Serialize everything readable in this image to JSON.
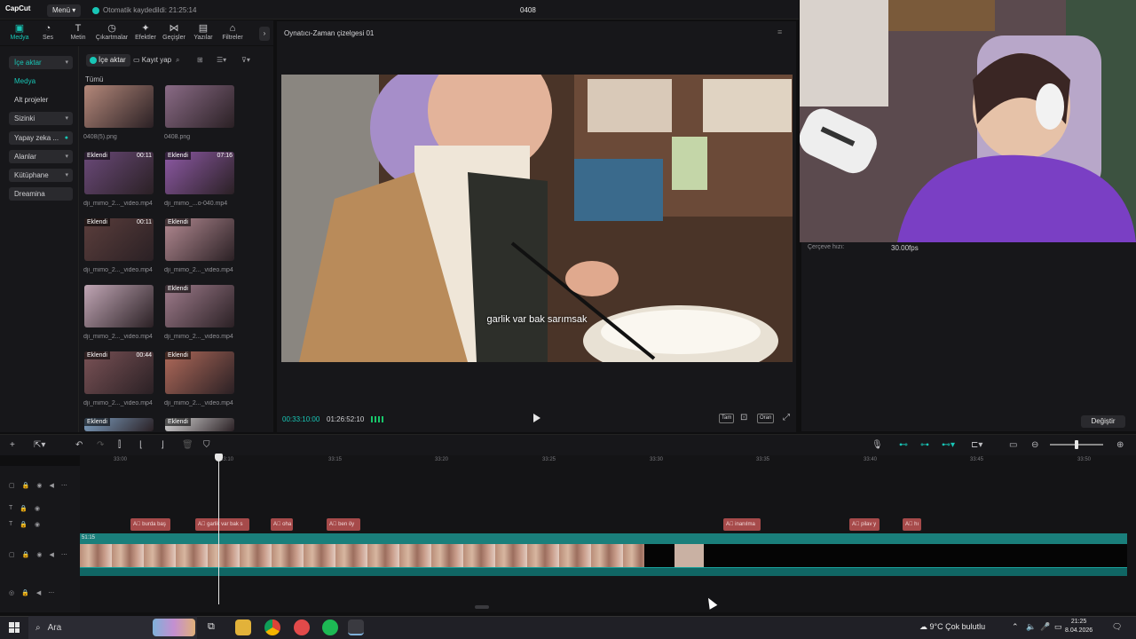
{
  "app": {
    "logo": "CapCut",
    "menu_label": "Menü",
    "autosave": "Otomatik kaydedildi: 21:25:14",
    "project_title": "0408"
  },
  "toolbar": {
    "items": [
      "Medya",
      "Ses",
      "Metin",
      "Çıkartmalar",
      "Efektler",
      "Geçişler",
      "Yazılar",
      "Filtreler"
    ],
    "active": "Medya",
    "more": "›"
  },
  "leftnav": {
    "items": [
      {
        "label": "İçe aktar",
        "chevron": "▾",
        "state": "highlight"
      },
      {
        "label": "Medya",
        "chevron": "",
        "state": "teal"
      },
      {
        "label": "Alt projeler",
        "chevron": "",
        "state": ""
      },
      {
        "label": "Sizinki",
        "chevron": "▾",
        "state": ""
      },
      {
        "label": "Yapay zeka ...",
        "chevron": "",
        "state": ""
      },
      {
        "label": "Alanlar",
        "chevron": "▾",
        "state": ""
      },
      {
        "label": "Kütüphane",
        "chevron": "▾",
        "state": ""
      },
      {
        "label": "Dreamina",
        "chevron": "",
        "state": ""
      }
    ]
  },
  "media": {
    "import_label": "İçe aktar",
    "record_label": "Kayıt yap",
    "all_label": "Tümü",
    "items": [
      {
        "name": "0408(5).png",
        "badge": "",
        "duration": "",
        "color": "#b4887a"
      },
      {
        "name": "0408.png",
        "badge": "",
        "duration": "",
        "color": "#8a6b86"
      },
      {
        "name": "dji_mimo_2..._video.mp4",
        "badge": "Eklendi",
        "duration": "00:11",
        "color": "#6b4a7a"
      },
      {
        "name": "dji_mimo_...o-040.mp4",
        "badge": "Eklendi",
        "duration": "07:16",
        "color": "#8e5aa6"
      },
      {
        "name": "dji_mimo_2..._video.mp4",
        "badge": "Eklendi",
        "duration": "00:11",
        "color": "#5b3e3c"
      },
      {
        "name": "dji_mimo_2..._video.mp4",
        "badge": "Eklendi",
        "duration": "",
        "color": "#b38a92"
      },
      {
        "name": "dji_mimo_2..._video.mp4",
        "badge": "",
        "duration": "",
        "color": "#c1a6b5"
      },
      {
        "name": "dji_mimo_2..._video.mp4",
        "badge": "Eklendi",
        "duration": "",
        "color": "#9f7c8c"
      },
      {
        "name": "dji_mimo_2..._video.mp4",
        "badge": "Eklendi",
        "duration": "00:44",
        "color": "#7a5256"
      },
      {
        "name": "dji_mimo_2..._video.mp4",
        "badge": "Eklendi",
        "duration": "",
        "color": "#b06a5a"
      },
      {
        "name": "",
        "badge": "Eklendi",
        "duration": "",
        "color": "#7ea0c2"
      },
      {
        "name": "",
        "badge": "Eklendi",
        "duration": "",
        "color": "#d8d8d8"
      }
    ]
  },
  "player": {
    "title": "Oynatıcı-Zaman çizelgesi 01",
    "subtitle": "garlik var bak sarımsak",
    "time_current": "00:33:10:00",
    "time_total": "01:26:52:10",
    "btn_full": "Tam",
    "btn_ratio": "Oran"
  },
  "properties": {
    "frame_rate_label": "Çerçeve hızı:",
    "frame_rate_value": "30.00fps",
    "change_label": "Değiştir"
  },
  "timeline": {
    "ruler_ticks": [
      "33:00",
      "33:10",
      "33:15",
      "33:20",
      "33:25",
      "33:30",
      "33:35",
      "33:40",
      "33:45",
      "33:50"
    ],
    "text_clips": [
      "burda baş",
      "garlik var bak s",
      "oha",
      "ben öy",
      "inanılma",
      "pilav y",
      "hı"
    ],
    "video_track_time": "51:15"
  },
  "taskbar": {
    "search_placeholder": "Ara",
    "weather": "9°C  Çok bulutlu",
    "time": "21:25",
    "date": "8.04.2026"
  },
  "colors": {
    "accent": "#18c6b6",
    "text_clip": "#a64a4a",
    "video_track": "#1a7f7b"
  }
}
